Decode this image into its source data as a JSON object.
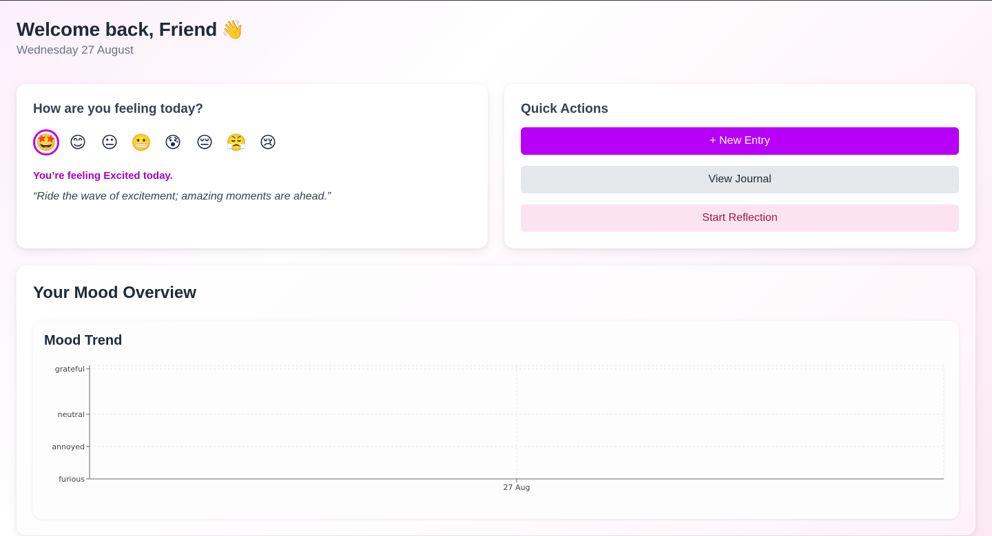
{
  "header": {
    "welcome": "Welcome back, Friend",
    "wave_emoji": "👋",
    "date": "Wednesday 27 August"
  },
  "mood_card": {
    "title": "How are you feeling today?",
    "emojis": [
      {
        "name": "excited",
        "glyph": "🤩",
        "selected": true
      },
      {
        "name": "happy",
        "glyph": "😊",
        "selected": false
      },
      {
        "name": "neutral",
        "glyph": "😐",
        "selected": false
      },
      {
        "name": "grimacing",
        "glyph": "😬",
        "selected": false
      },
      {
        "name": "anxious",
        "glyph": "😰",
        "selected": false
      },
      {
        "name": "pensive",
        "glyph": "😔",
        "selected": false
      },
      {
        "name": "frustrated",
        "glyph": "😤",
        "selected": false
      },
      {
        "name": "sad",
        "glyph": "😢",
        "selected": false
      }
    ],
    "feeling_text": "You’re feeling Excited today.",
    "quote": "“Ride the wave of excitement; amazing moments are ahead.”"
  },
  "actions_card": {
    "title": "Quick Actions",
    "new_entry": "+ New Entry",
    "view_journal": "View Journal",
    "start_reflection": "Start Reflection"
  },
  "overview": {
    "title": "Your Mood Overview",
    "trend_title": "Mood Trend"
  },
  "colors": {
    "accent": "#b600f8",
    "feeling_text": "#a100c8",
    "selected_ring": "#c000e0",
    "reflection_bg": "#fde3f0",
    "reflection_text": "#9d174d"
  },
  "chart_data": {
    "type": "line",
    "title": "Mood Trend",
    "y_categories": [
      "furious",
      "annoyed",
      "neutral",
      "grateful"
    ],
    "x": [
      "27 Aug"
    ],
    "series": [
      {
        "values": []
      }
    ],
    "grid": true
  }
}
